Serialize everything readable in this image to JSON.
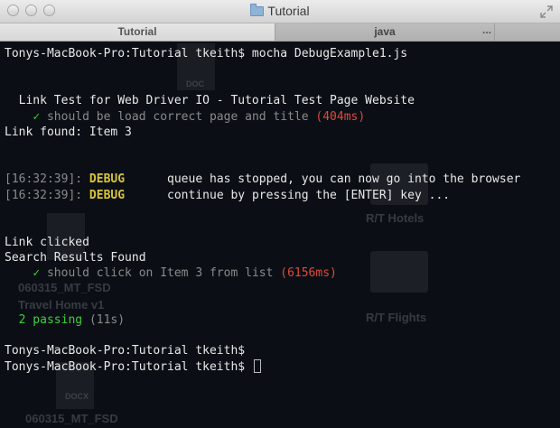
{
  "window": {
    "title": "Tutorial",
    "tabs": [
      {
        "label": "Tutorial",
        "active": true
      },
      {
        "label": "java",
        "active": false
      }
    ],
    "tab_overflow": "..."
  },
  "background_files": [
    {
      "label": "DOC"
    },
    {
      "label": "R/T Hotels"
    },
    {
      "label": "R/T Flights"
    },
    {
      "label": "060315_MT_FSD"
    },
    {
      "label": "Travel Home v1"
    },
    {
      "label": "DOCX"
    },
    {
      "label": "060315_MT_FSD"
    }
  ],
  "terminal": {
    "prompt1": "Tonys-MacBook-Pro:Tutorial tkeith$ mocha DebugExample1.js",
    "suite_title": "  Link Test for Web Driver IO - Tutorial Test Page Website",
    "test1_check": "✓",
    "test1_text": "should be load correct page and title",
    "test1_time": "(404ms)",
    "link_found": "Link found: Item 3",
    "debug1_time": "[16:32:39]:",
    "debug1_level": "DEBUG",
    "debug1_msg": "queue has stopped, you can now go into the browser",
    "debug2_time": "[16:32:39]:",
    "debug2_level": "DEBUG",
    "debug2_msg": "continue by pressing the [ENTER] key ...",
    "link_clicked": "Link clicked",
    "search_results": "Search Results Found",
    "test2_check": "✓",
    "test2_text": "should click on Item 3 from list",
    "test2_time": "(6156ms)",
    "passing": "2 passing",
    "passing_time": "(11s)",
    "prompt2": "Tonys-MacBook-Pro:Tutorial tkeith$",
    "prompt3": "Tonys-MacBook-Pro:Tutorial tkeith$"
  }
}
